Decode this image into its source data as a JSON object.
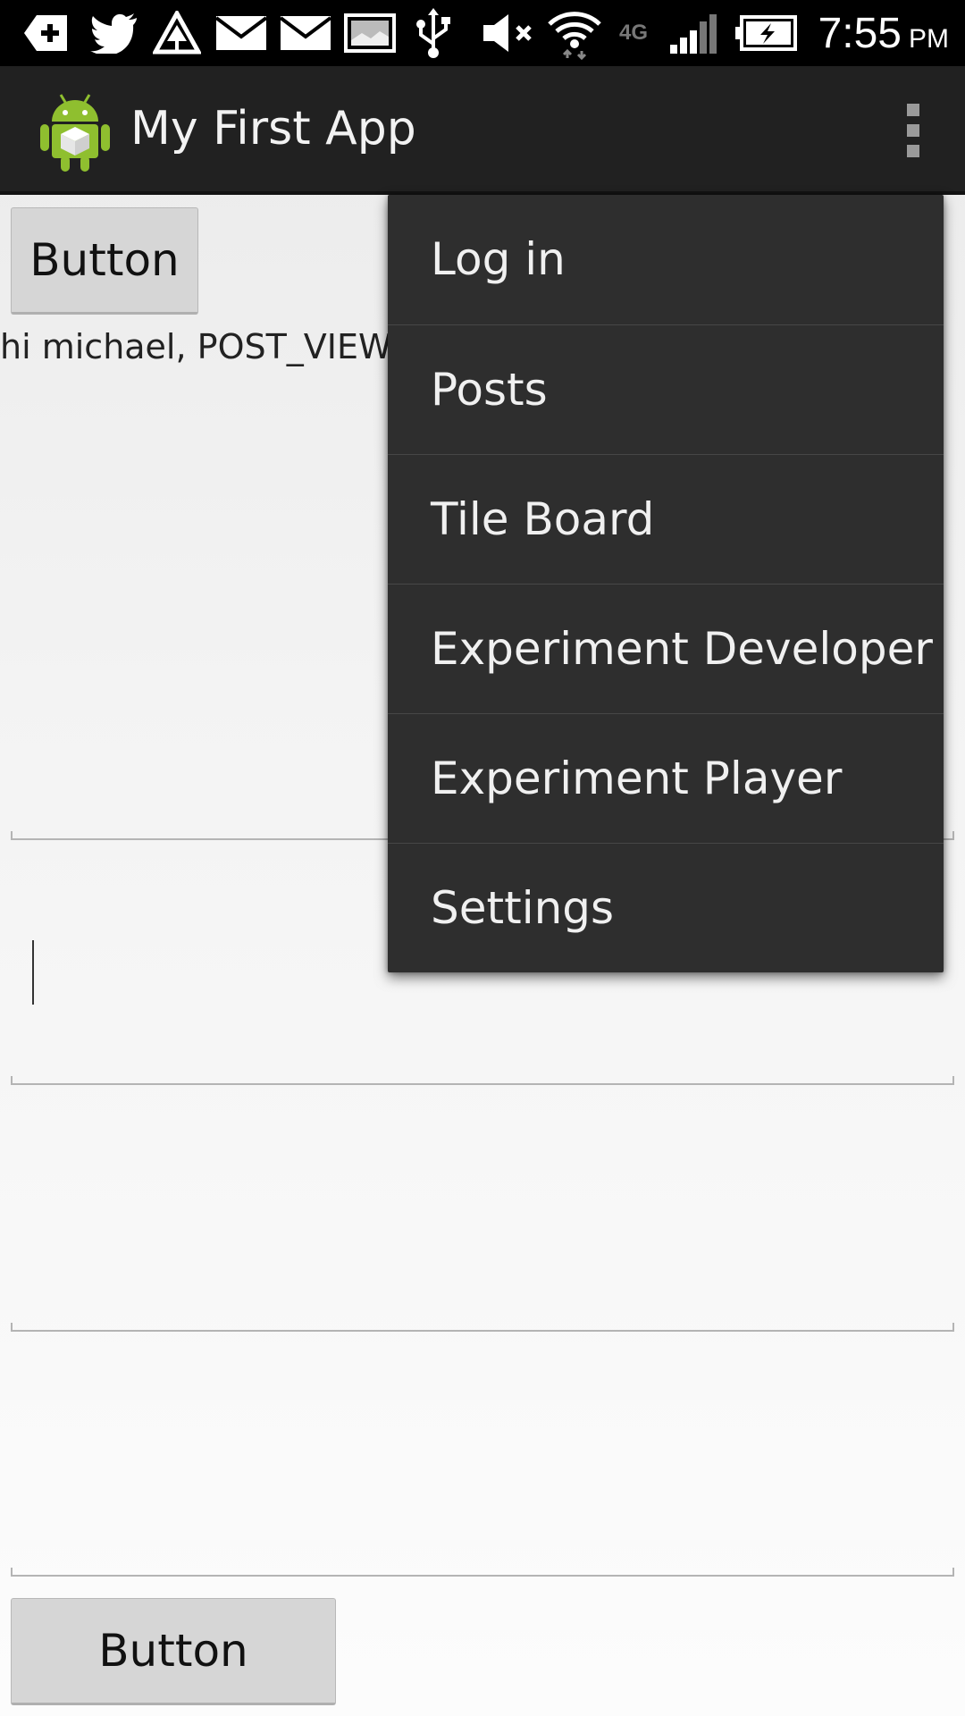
{
  "status_bar": {
    "time": "7:55",
    "ampm": "PM",
    "network_label": "4G",
    "icons": [
      "add-box-icon",
      "twitter-icon",
      "alert-icon",
      "mail-icon",
      "mail-icon",
      "image-icon",
      "usb-icon",
      "mute-icon",
      "wifi-icon",
      "network-4g-icon",
      "signal-icon",
      "battery-charging-icon"
    ]
  },
  "action_bar": {
    "title": "My First App",
    "icon": "android-app-icon",
    "overflow_icon": "overflow-menu-icon"
  },
  "content": {
    "top_button_label": "Button",
    "greeting_text": "hi michael, POST_VIEW",
    "bottom_button_label": "Button"
  },
  "menu": {
    "items": [
      {
        "label": "Log in"
      },
      {
        "label": "Posts"
      },
      {
        "label": "Tile Board"
      },
      {
        "label": "Experiment Developer"
      },
      {
        "label": "Experiment Player"
      },
      {
        "label": "Settings"
      }
    ]
  },
  "colors": {
    "status_bar_bg": "#000000",
    "action_bar_bg": "#212121",
    "menu_bg": "#2e2e2e",
    "button_bg": "#d6d6d6",
    "android_green": "#8fbf2f"
  }
}
